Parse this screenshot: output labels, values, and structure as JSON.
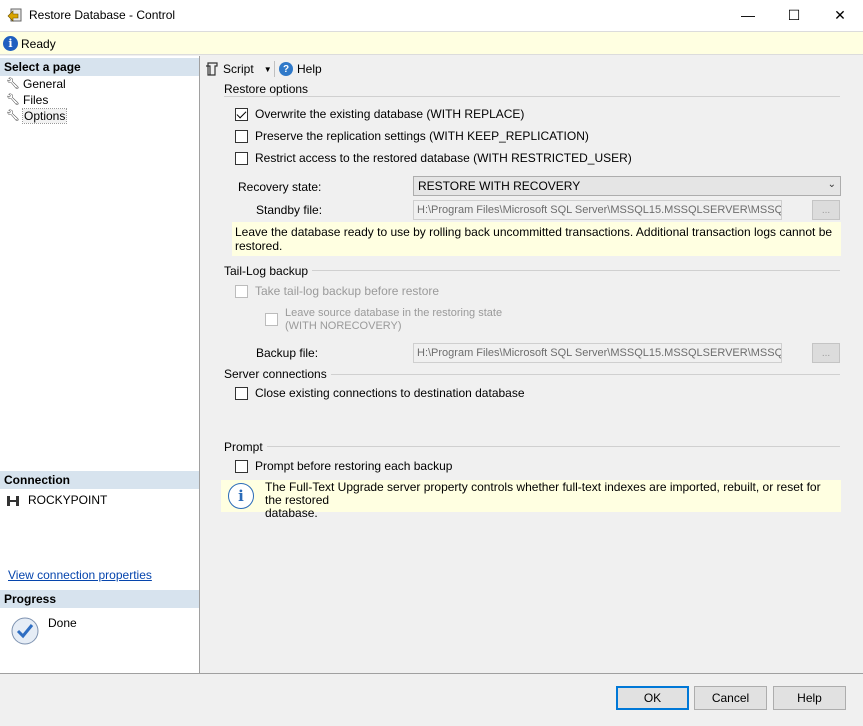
{
  "window": {
    "title": "Restore Database - Control",
    "minimize_glyph": "—",
    "maximize_glyph": "☐",
    "close_glyph": "✕"
  },
  "status": {
    "text": "Ready",
    "icon": "info-icon"
  },
  "left": {
    "select_page_header": "Select a page",
    "pages": [
      {
        "label": "General"
      },
      {
        "label": "Files"
      },
      {
        "label": "Options"
      }
    ],
    "connection_header": "Connection",
    "server_name": "ROCKYPOINT",
    "view_connection_link": "View connection properties",
    "progress_header": "Progress",
    "progress_status": "Done"
  },
  "toolbar": {
    "script_label": "Script",
    "help_label": "Help"
  },
  "restore_options": {
    "header": "Restore options",
    "overwrite": {
      "label": "Overwrite the existing database (WITH REPLACE)",
      "checked": true
    },
    "preserve": {
      "label": "Preserve the replication settings (WITH KEEP_REPLICATION)",
      "checked": false
    },
    "restrict": {
      "label": "Restrict access to the restored database (WITH RESTRICTED_USER)",
      "checked": false
    },
    "recovery_label": "Recovery state:",
    "recovery_value": "RESTORE WITH RECOVERY",
    "standby_label": "Standby file:",
    "standby_value": "H:\\Program Files\\Microsoft SQL Server\\MSSQL15.MSSQLSERVER\\MSSQL",
    "browse_label": "...",
    "note": "Leave the database ready to use by rolling back uncommitted transactions. Additional transaction logs cannot be restored."
  },
  "tail_log": {
    "header": "Tail-Log backup",
    "take_backup_label": "Take tail-log backup before restore",
    "leave_source_line1": "Leave source database in the restoring state",
    "leave_source_line2": "(WITH NORECOVERY)",
    "backup_file_label": "Backup file:",
    "backup_file_value": "H:\\Program Files\\Microsoft SQL Server\\MSSQL15.MSSQLSERVER\\MSSQL",
    "browse_label": "..."
  },
  "server_connections": {
    "header": "Server connections",
    "close_label": "Close existing connections to destination database"
  },
  "prompt": {
    "header": "Prompt",
    "prompt_label": "Prompt before restoring each backup",
    "info_text_line1": "The Full-Text Upgrade server property controls whether full-text indexes are imported, rebuilt, or reset for the restored",
    "info_text_line2": "database."
  },
  "footer": {
    "ok": "OK",
    "cancel": "Cancel",
    "help": "Help"
  },
  "colors": {
    "status_bg": "#ffffe1",
    "section_header_bg": "#d7e3ee",
    "link": "#0645ad",
    "primary_border": "#0078d7"
  }
}
